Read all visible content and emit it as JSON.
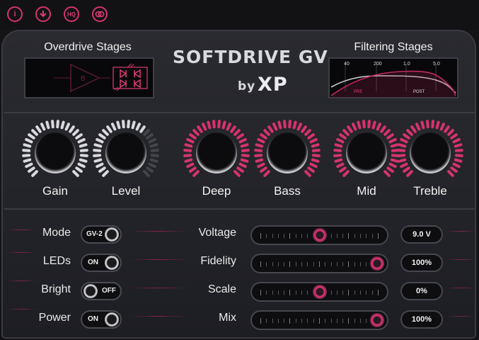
{
  "topbar": {
    "info_label": "i",
    "hq_label": "HQ"
  },
  "brand": {
    "title": "SOFTDRIVE GV",
    "by": "by",
    "maker": "XP"
  },
  "overdrive": {
    "title": "Overdrive Stages",
    "stage_label": "B"
  },
  "filtering": {
    "title": "Filtering Stages",
    "freq_labels": [
      "40",
      "200",
      "1.0",
      "5.0"
    ],
    "pre": "PRE",
    "post": "POST"
  },
  "knobs": [
    {
      "id": "gain",
      "label": "Gain",
      "style": "white"
    },
    {
      "id": "level",
      "label": "Level",
      "style": "white"
    },
    {
      "id": "deep",
      "label": "Deep",
      "style": "pink"
    },
    {
      "id": "bass",
      "label": "Bass",
      "style": "pink"
    },
    {
      "id": "mid",
      "label": "Mid",
      "style": "pink"
    },
    {
      "id": "treble",
      "label": "Treble",
      "style": "pink"
    }
  ],
  "switches": {
    "mode": {
      "label": "Mode",
      "value": "GV-2"
    },
    "leds": {
      "label": "LEDs",
      "value": "ON"
    },
    "bright": {
      "label": "Bright",
      "value": "OFF"
    },
    "power": {
      "label": "Power",
      "value": "ON"
    }
  },
  "sliders": {
    "voltage": {
      "label": "Voltage",
      "display": "9.0 V",
      "level": 0.5
    },
    "fidelity": {
      "label": "Fidelity",
      "display": "100%",
      "level": 1.0
    },
    "scale": {
      "label": "Scale",
      "display": "0%",
      "level": 0.5
    },
    "mix": {
      "label": "Mix",
      "display": "100%",
      "level": 1.0
    }
  },
  "colors": {
    "accent": "#e23a78",
    "panel": "#25262b",
    "background": "#141417"
  },
  "icons": [
    "info-icon",
    "download-icon",
    "hq-icon",
    "link-icon"
  ]
}
